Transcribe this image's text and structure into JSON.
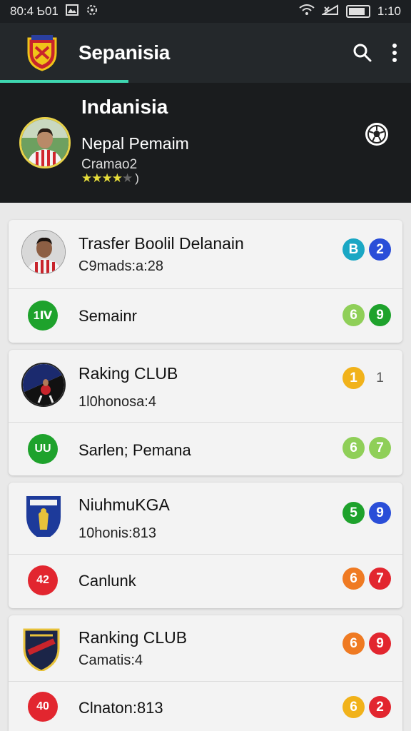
{
  "status_bar": {
    "time_left": "80:4 Ƅ01",
    "time_right": "1:10"
  },
  "app_bar": {
    "title": "Sepanisia",
    "icons": [
      "club-crest-icon",
      "search-icon",
      "more-vert-icon"
    ]
  },
  "profile": {
    "title": "Indanisia",
    "name": "Nepal Pemaim",
    "subtitle": "Cramao2",
    "rating_stars": 4,
    "rating_max": 5,
    "rating_tail": ")",
    "action_icon": "soccer-ball-icon"
  },
  "cards": [
    {
      "title": "Trasfer Boolil Delanain",
      "subtitle": "C9mads:a:28",
      "top_icon": "player-avatar",
      "top_pills": [
        {
          "text": "B",
          "color": "#1aa7c4"
        },
        {
          "text": "2",
          "color": "#2a4ed8"
        }
      ],
      "bottom_badge": {
        "text": "1Ⅳ",
        "color": "#1ea22c"
      },
      "bottom_label": "Semainr",
      "bottom_pills": [
        {
          "text": "6",
          "color": "#8fcf58"
        },
        {
          "text": "9",
          "color": "#1ea22c"
        }
      ]
    },
    {
      "title": "Raking CLUB",
      "subtitle": "1l0honosa:4",
      "top_icon": "club-photo-avatar",
      "top_pills": [
        {
          "text": "1",
          "color": "#f1b21a"
        },
        {
          "text": "1",
          "color": ""
        }
      ],
      "bottom_badge": {
        "text": "UU",
        "color": "#1ea22c"
      },
      "bottom_label": "Sarlen; Pemana",
      "bottom_pills": [
        {
          "text": "6",
          "color": "#8fcf58"
        },
        {
          "text": "7",
          "color": "#8fcf58"
        }
      ]
    },
    {
      "title": "NiuhmuKGA",
      "subtitle": "10honis:813",
      "top_icon": "blue-club-crest",
      "top_pills": [
        {
          "text": "5",
          "color": "#1ea22c"
        },
        {
          "text": "9",
          "color": "#2a4ed8"
        }
      ],
      "bottom_badge": {
        "text": "42",
        "color": "#e2262f"
      },
      "bottom_label": "Canlunk",
      "bottom_pills": [
        {
          "text": "6",
          "color": "#ef7a22"
        },
        {
          "text": "7",
          "color": "#e2262f"
        }
      ]
    },
    {
      "title": "Ranking CLUB",
      "subtitle": "Camatis:4",
      "top_icon": "shield-club-crest",
      "top_pills": [
        {
          "text": "6",
          "color": "#ef7a22"
        },
        {
          "text": "9",
          "color": "#e2262f"
        }
      ],
      "bottom_badge": {
        "text": "40",
        "color": "#e2262f"
      },
      "bottom_label": "Clnaton:813",
      "bottom_pills": [
        {
          "text": "6",
          "color": "#f1b21a"
        },
        {
          "text": "2",
          "color": "#e2262f"
        }
      ]
    }
  ]
}
